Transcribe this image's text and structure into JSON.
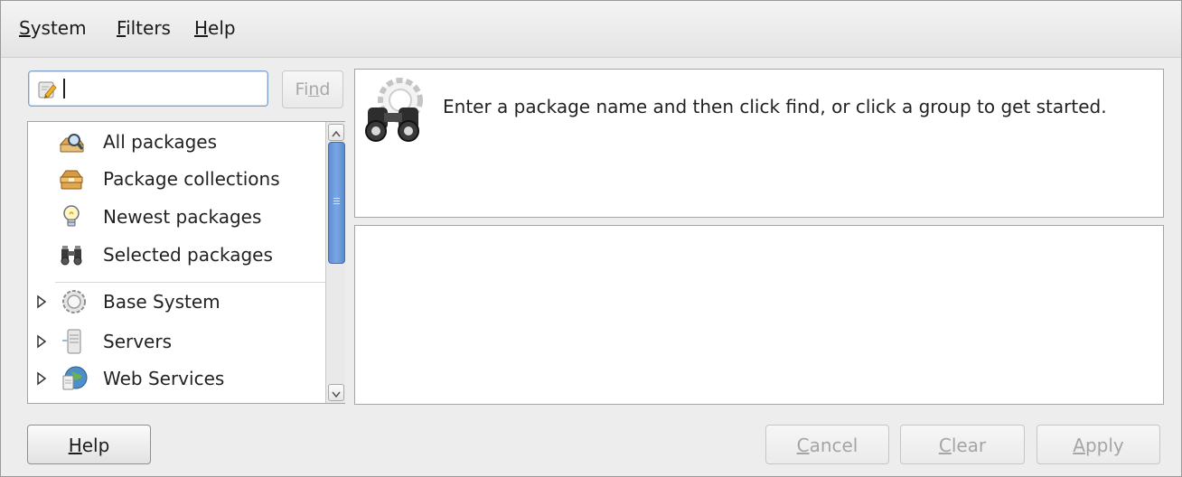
{
  "menu": {
    "items": [
      {
        "mnemonic": "S",
        "rest": "ystem"
      },
      {
        "mnemonic": "F",
        "rest": "ilters"
      },
      {
        "mnemonic": "H",
        "rest": "elp"
      }
    ]
  },
  "search": {
    "value": "",
    "find_label_pre": "Fi",
    "find_label_mn": "n",
    "find_label_post": "d"
  },
  "groups": [
    {
      "label": "All packages",
      "icon": "all-packages-icon"
    },
    {
      "label": "Package collections",
      "icon": "package-collections-icon"
    },
    {
      "label": "Newest packages",
      "icon": "newest-packages-icon"
    },
    {
      "label": "Selected packages",
      "icon": "selected-packages-icon"
    },
    {
      "label": "Base System",
      "icon": "base-system-icon"
    },
    {
      "label": "Servers",
      "icon": "servers-icon"
    },
    {
      "label": "Web Services",
      "icon": "web-services-icon"
    }
  ],
  "info": {
    "message": "Enter a package name and then click find, or click a group to get started."
  },
  "buttons": {
    "help": {
      "mnemonic": "H",
      "rest": "elp"
    },
    "cancel": {
      "mnemonic": "C",
      "rest": "ancel"
    },
    "clear": {
      "mnemonic": "C",
      "rest": "lear"
    },
    "apply": {
      "mnemonic": "A",
      "rest": "pply"
    }
  },
  "colors": {
    "scroll_thumb": "#6b99dc",
    "disabled_text": "#a5a5a5"
  }
}
